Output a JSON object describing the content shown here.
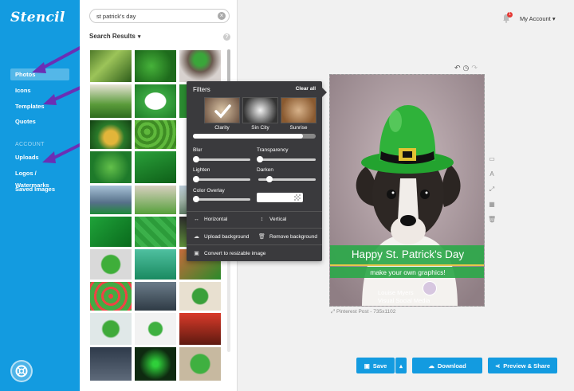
{
  "app": {
    "logo": "Stencil"
  },
  "sidebar": {
    "items": [
      {
        "label": "Photos",
        "active": true
      },
      {
        "label": "Icons"
      },
      {
        "label": "Templates"
      },
      {
        "label": "Quotes"
      }
    ],
    "account_heading": "ACCOUNT",
    "account_items": [
      {
        "label": "Uploads"
      },
      {
        "label": "Logos / Watermarks"
      },
      {
        "label": "Saved Images"
      }
    ]
  },
  "search": {
    "value": "st patrick's day",
    "results_label": "Search Results"
  },
  "filters": {
    "title": "Filters",
    "clear_all": "Clear all",
    "presets": [
      {
        "label": "Clarity",
        "selected": true
      },
      {
        "label": "Sin City"
      },
      {
        "label": "Sunrise"
      }
    ],
    "sliders": {
      "blur": "Blur",
      "transparency": "Transparency",
      "lighten": "Lighten",
      "darken": "Darken",
      "color_overlay": "Color Overlay"
    },
    "actions": {
      "horizontal": "Horizontal",
      "vertical": "Vertical",
      "upload_bg": "Upload background",
      "remove_bg": "Remove background",
      "convert": "Convert to resizable image"
    }
  },
  "header": {
    "account": "My Account",
    "notifications": "1"
  },
  "canvas": {
    "headline": "Happy St. Patrick's Day",
    "subline": "make your own graphics!",
    "author": "Louise Myers",
    "brand": "Visual Social Media",
    "size_label": "Pinterest Post - 735x1102"
  },
  "toolbar": {
    "save": "Save",
    "download": "Download",
    "share": "Preview & Share"
  },
  "colors": {
    "accent": "#139be0",
    "green": "#2ca84a"
  }
}
